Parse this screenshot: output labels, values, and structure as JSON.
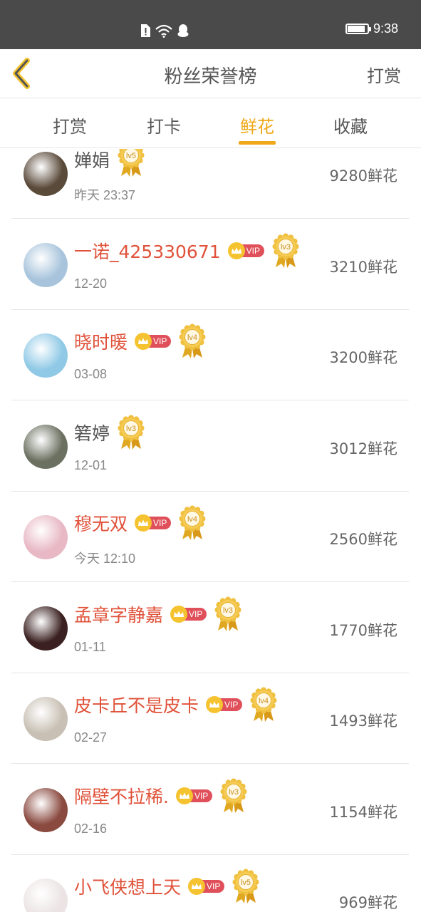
{
  "status_bar": {
    "time": "9:38",
    "battery_level": 0.9
  },
  "header": {
    "title": "粉丝荣誉榜",
    "action": "打赏"
  },
  "tabs": [
    {
      "label": "打赏",
      "active": false
    },
    {
      "label": "打卡",
      "active": false
    },
    {
      "label": "鲜花",
      "active": true
    },
    {
      "label": "收藏",
      "active": false
    }
  ],
  "fans": [
    {
      "name": "婵娟",
      "vip": false,
      "level": "lv5",
      "date": "昨天 23:37",
      "amount": "9280鲜花",
      "avatar_color": "#5a4a3a"
    },
    {
      "name": "一诺_425330671",
      "vip": true,
      "vip_label": "VIP",
      "level": "lv3",
      "date": "12-20",
      "amount": "3210鲜花",
      "avatar_color": "#a8c4dc"
    },
    {
      "name": "晓时暖",
      "vip": true,
      "vip_label": "VIP",
      "level": "lv4",
      "date": "03-08",
      "amount": "3200鲜花",
      "avatar_color": "#8fc9e6"
    },
    {
      "name": "箬婷",
      "vip": false,
      "level": "lv3",
      "date": "12-01",
      "amount": "3012鲜花",
      "avatar_color": "#6b7060"
    },
    {
      "name": "穆无双",
      "vip": true,
      "vip_label": "VIP",
      "level": "lv4",
      "date": "今天 12:10",
      "amount": "2560鲜花",
      "avatar_color": "#e8b8c4"
    },
    {
      "name": "孟章字静嘉",
      "vip": true,
      "vip_label": "VIP",
      "level": "lv3",
      "date": "01-11",
      "amount": "1770鲜花",
      "avatar_color": "#3a2020"
    },
    {
      "name": "皮卡丘不是皮卡",
      "vip": true,
      "vip_label": "VIP",
      "level": "lv4",
      "date": "02-27",
      "amount": "1493鲜花",
      "avatar_color": "#c8c0b4"
    },
    {
      "name": "隔壁不拉稀.",
      "vip": true,
      "vip_label": "VIP",
      "level": "lv3",
      "date": "02-16",
      "amount": "1154鲜花",
      "avatar_color": "#8a4a40"
    },
    {
      "name": "小飞侠想上天",
      "vip": true,
      "vip_label": "VIP",
      "level": "lv5",
      "date": "",
      "amount": "969鲜花",
      "avatar_color": "#ece4e4"
    }
  ]
}
